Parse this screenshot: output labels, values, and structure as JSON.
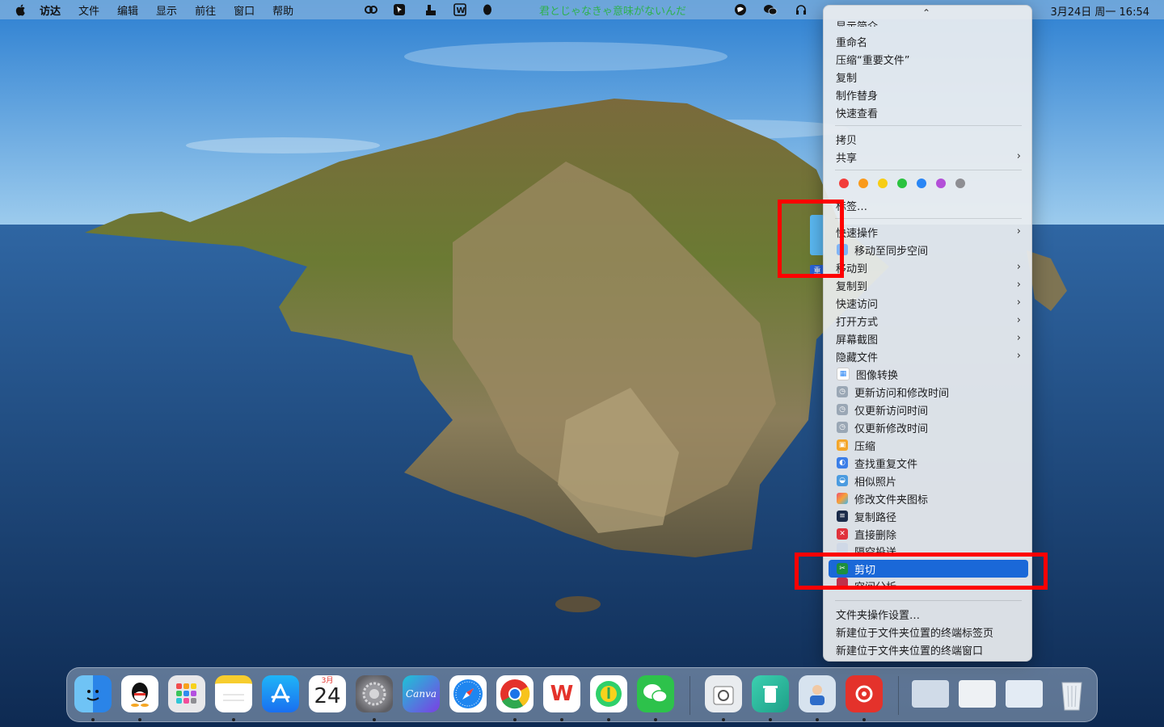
{
  "menubar": {
    "app_name": "访达",
    "items": [
      "文件",
      "编辑",
      "显示",
      "前往",
      "窗口",
      "帮助"
    ],
    "lyrics": "君とじゃなきゃ意味がないんだ",
    "clock": "3月24日 周一  16:54",
    "status_icons": [
      "baidu-netdisk-icon",
      "cursor-app-icon",
      "control-icon",
      "wps-icon",
      "qq-status-icon",
      "vpn-globe-icon",
      "wechat-status-icon",
      "headphone-icon"
    ]
  },
  "desktop": {
    "folder_label": "重"
  },
  "context_menu": {
    "partial_top": "显示简介",
    "items_group1": [
      "重命名",
      "压缩“重要文件”",
      "复制",
      "制作替身",
      "快速查看"
    ],
    "items_group2": [
      "拷贝",
      "共享"
    ],
    "tag_colors": [
      "#f23d3a",
      "#f99a1c",
      "#f7cd14",
      "#2bc33f",
      "#2a86f5",
      "#b34fd8",
      "#8e8e93"
    ],
    "tags_label": "标签…",
    "items_group3": [
      "快速操作",
      "移动至同步空间",
      "移动到",
      "复制到",
      "快速访问",
      "打开方式",
      "屏幕截图",
      "隐藏文件",
      "图像转换",
      "更新访问和修改时间",
      "仅更新访问时间",
      "仅更新修改时间",
      "压缩",
      "查找重复文件",
      "相似照片",
      "修改文件夹图标",
      "复制路径",
      "直接删除",
      "隔空投送",
      "剪切",
      "空间分析"
    ],
    "items_group4": [
      "文件夹操作设置…",
      "新建位于文件夹位置的终端标签页",
      "新建位于文件夹位置的终端窗口"
    ],
    "highlighted": "剪切"
  },
  "dock": {
    "calendar_month": "3月",
    "calendar_day": "24",
    "apps": [
      "finder-icon",
      "qq-icon",
      "launchpad-icon",
      "notes-icon",
      "app-store-icon",
      "calendar-icon",
      "system-settings-icon",
      "canva-icon",
      "safari-icon",
      "chrome-icon",
      "wps-office-icon",
      "qq-music-icon",
      "wechat-icon",
      "disk-utility-icon",
      "trash-cleaner-icon",
      "preview-person-icon",
      "netease-music-icon",
      "window-thumb-1-icon",
      "window-thumb-2-icon",
      "window-thumb-3-icon",
      "trash-icon"
    ],
    "canva_label": "Canva",
    "wps_label": "W"
  }
}
